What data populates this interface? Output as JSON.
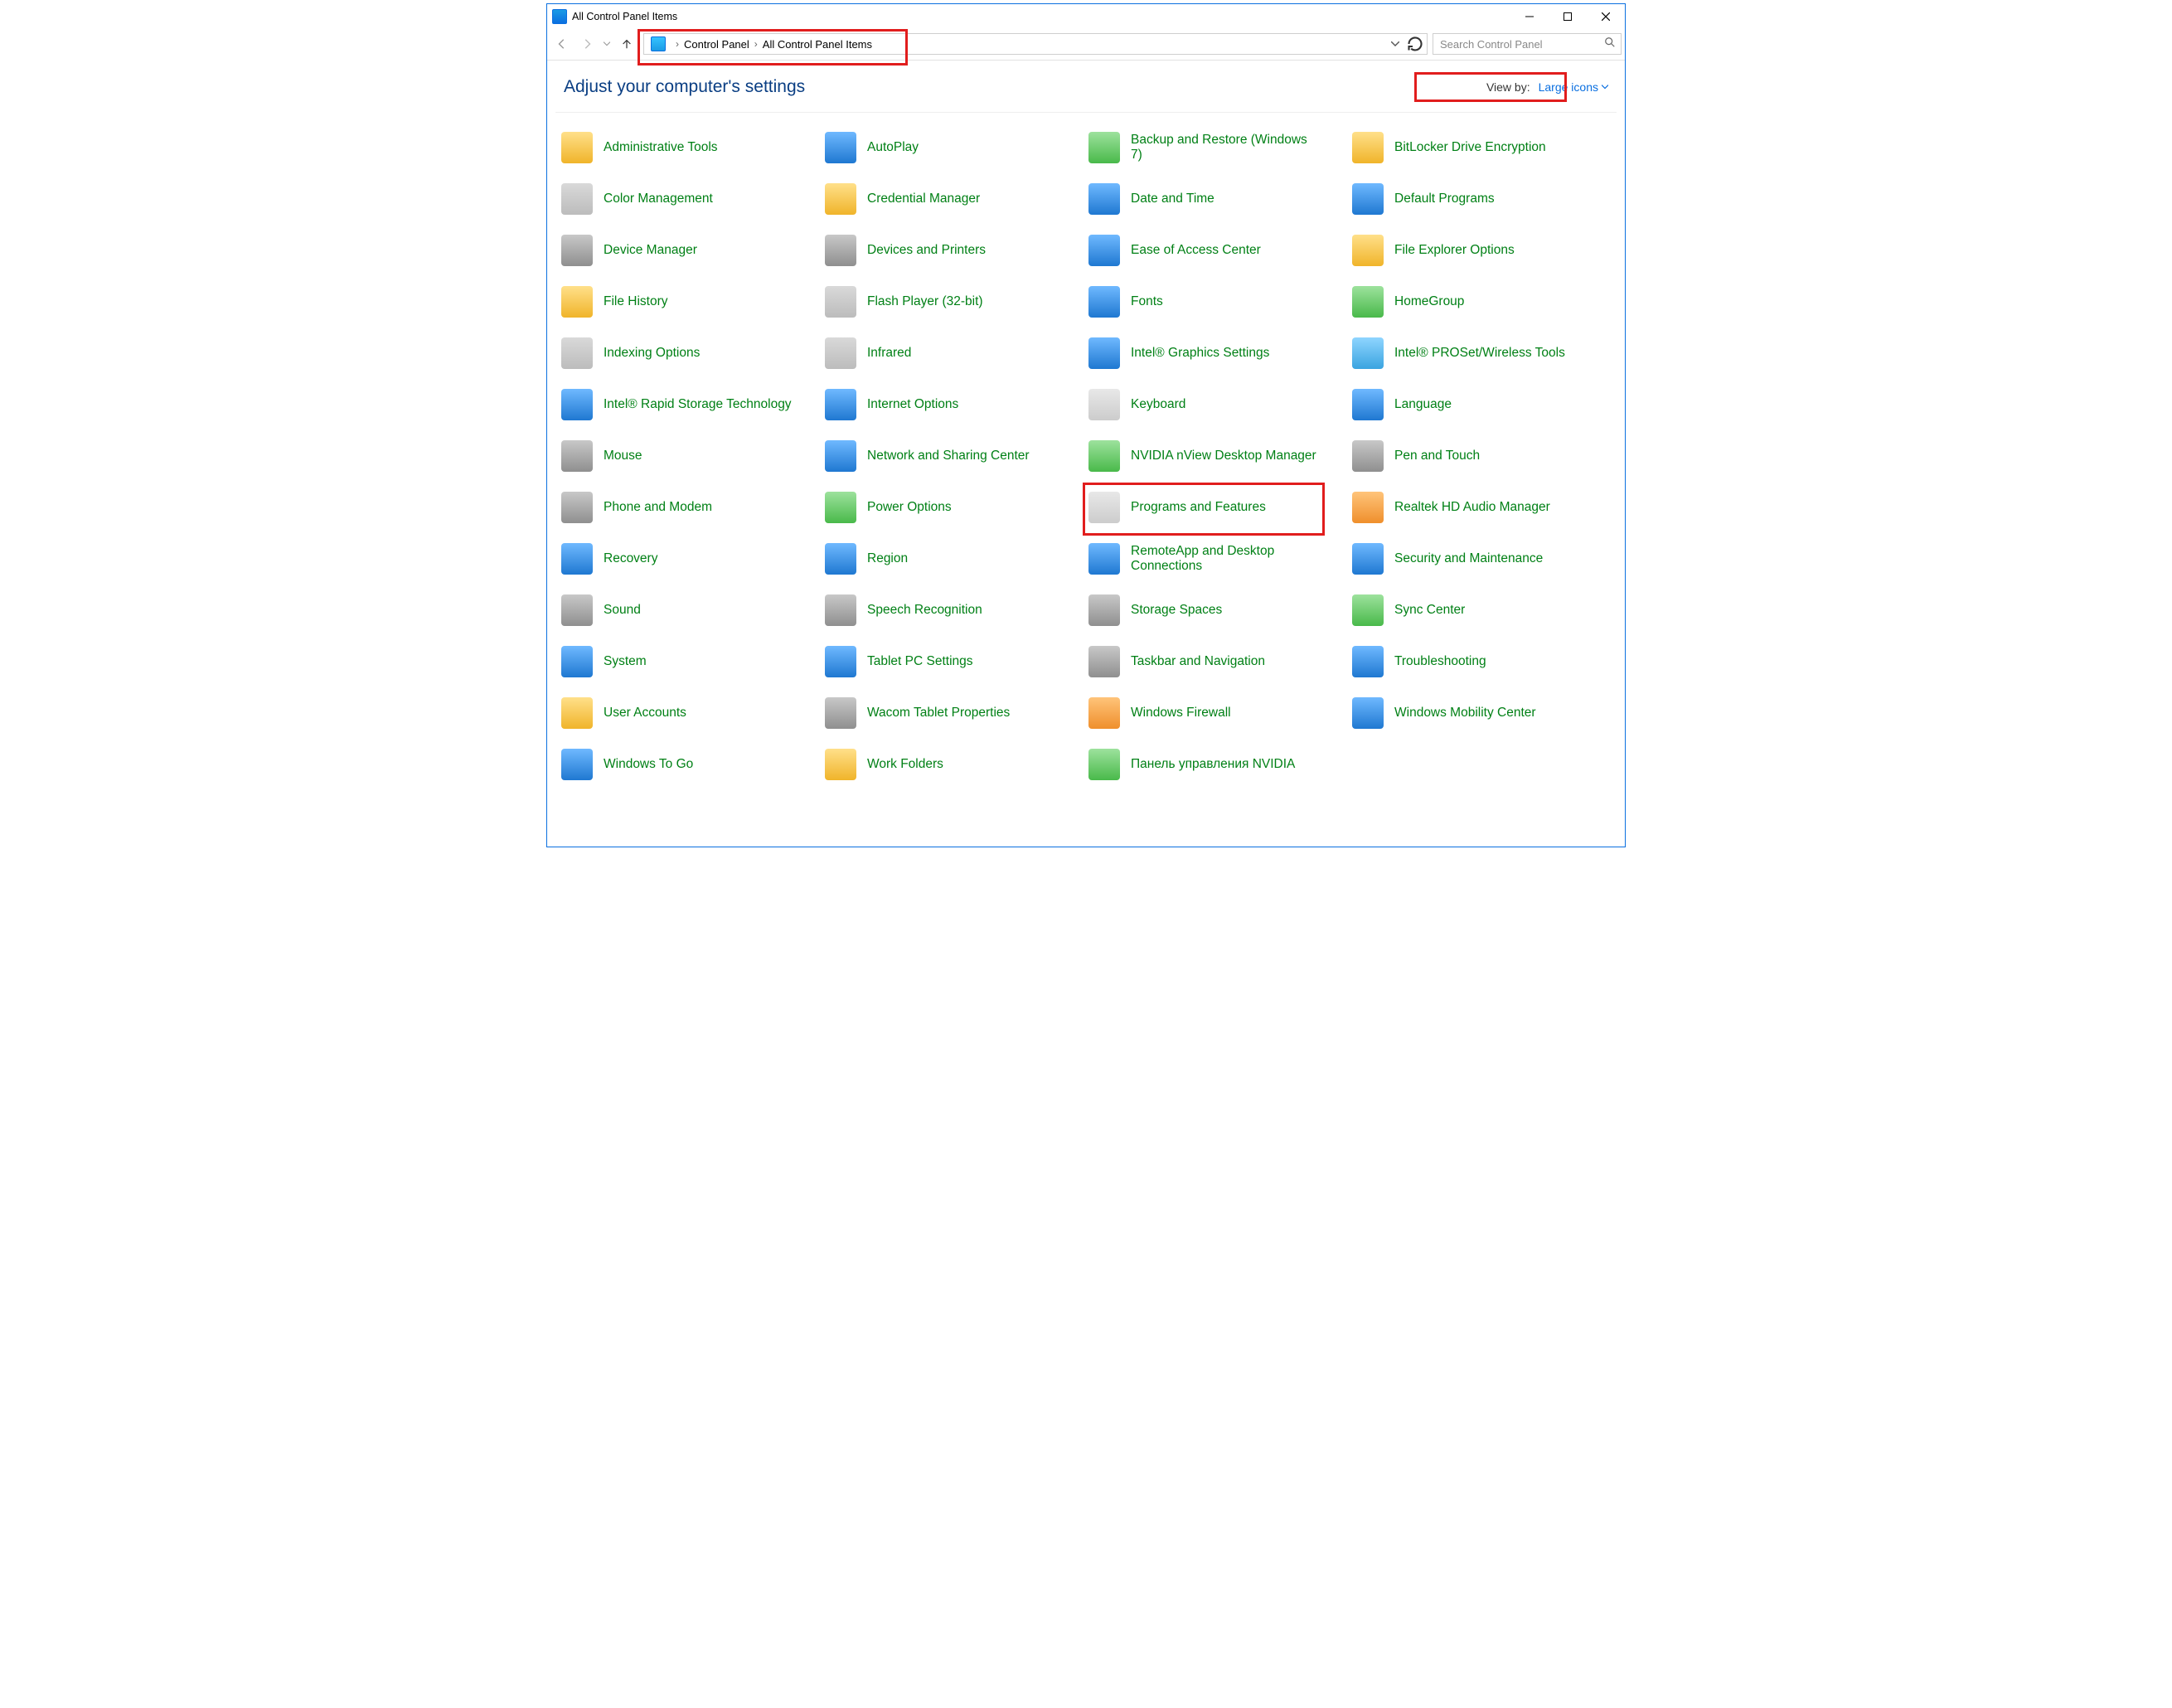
{
  "window": {
    "title": "All Control Panel Items"
  },
  "breadcrumb": {
    "item1": "Control Panel",
    "item2": "All Control Panel Items"
  },
  "search": {
    "placeholder": "Search Control Panel"
  },
  "heading": "Adjust your computer's settings",
  "viewBy": {
    "label": "View by:",
    "value": "Large icons"
  },
  "items": {
    "i0": "Administrative Tools",
    "i1": "AutoPlay",
    "i2": "Backup and Restore (Windows 7)",
    "i3": "BitLocker Drive Encryption",
    "i4": "Color Management",
    "i5": "Credential Manager",
    "i6": "Date and Time",
    "i7": "Default Programs",
    "i8": "Device Manager",
    "i9": "Devices and Printers",
    "i10": "Ease of Access Center",
    "i11": "File Explorer Options",
    "i12": "File History",
    "i13": "Flash Player (32-bit)",
    "i14": "Fonts",
    "i15": "HomeGroup",
    "i16": "Indexing Options",
    "i17": "Infrared",
    "i18": "Intel® Graphics Settings",
    "i19": "Intel® PROSet/Wireless Tools",
    "i20": "Intel® Rapid Storage Technology",
    "i21": "Internet Options",
    "i22": "Keyboard",
    "i23": "Language",
    "i24": "Mouse",
    "i25": "Network and Sharing Center",
    "i26": "NVIDIA nView Desktop Manager",
    "i27": "Pen and Touch",
    "i28": "Phone and Modem",
    "i29": "Power Options",
    "i30": "Programs and Features",
    "i31": "Realtek HD Audio Manager",
    "i32": "Recovery",
    "i33": "Region",
    "i34": "RemoteApp and Desktop Connections",
    "i35": "Security and Maintenance",
    "i36": "Sound",
    "i37": "Speech Recognition",
    "i38": "Storage Spaces",
    "i39": "Sync Center",
    "i40": "System",
    "i41": "Tablet PC Settings",
    "i42": "Taskbar and Navigation",
    "i43": "Troubleshooting",
    "i44": "User Accounts",
    "i45": "Wacom Tablet Properties",
    "i46": "Windows Firewall",
    "i47": "Windows Mobility Center",
    "i48": "Windows To Go",
    "i49": "Work Folders",
    "i50": "Панель управления NVIDIA"
  },
  "highlights": {
    "addressBar": true,
    "viewBy": true,
    "itemKey": "i30"
  }
}
